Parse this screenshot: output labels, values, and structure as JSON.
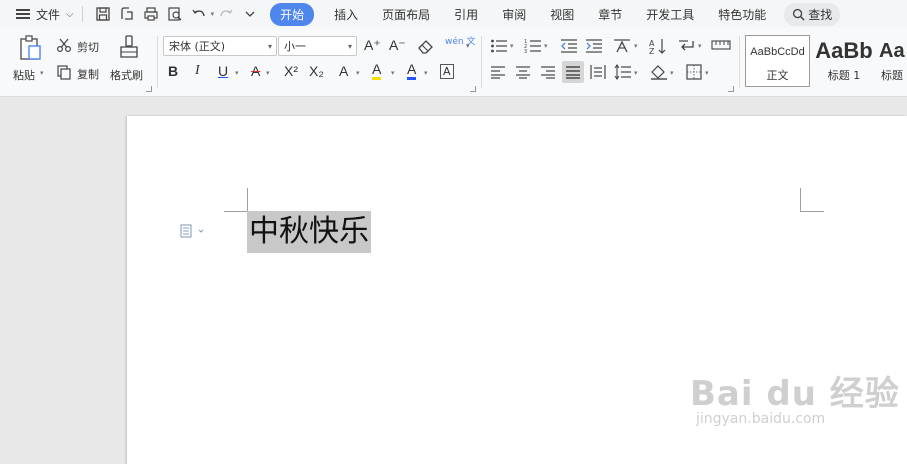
{
  "topbar": {
    "file_label": "文件",
    "tabs": [
      {
        "label": "开始",
        "active": true
      },
      {
        "label": "插入",
        "active": false
      },
      {
        "label": "页面布局",
        "active": false
      },
      {
        "label": "引用",
        "active": false
      },
      {
        "label": "审阅",
        "active": false
      },
      {
        "label": "视图",
        "active": false
      },
      {
        "label": "章节",
        "active": false
      },
      {
        "label": "开发工具",
        "active": false
      },
      {
        "label": "特色功能",
        "active": false
      }
    ],
    "search_label": "查找"
  },
  "ribbon": {
    "clipboard": {
      "paste": "粘贴",
      "cut": "剪切",
      "copy": "复制",
      "format_painter": "格式刷"
    },
    "font": {
      "family": "宋体 (正文)",
      "size": "小一",
      "bold": "B",
      "italic": "I",
      "underline": "U",
      "strike": "A",
      "superscript": "X²",
      "subscript": "X₂",
      "text_effect": "A",
      "highlight": "A",
      "font_color": "A",
      "char_border": "A",
      "grow": "A⁺",
      "shrink": "A⁻",
      "phonetic": "wén 文"
    },
    "styles": [
      {
        "sample": "AaBbCcDd",
        "name": "正文"
      },
      {
        "sample": "AaBb",
        "name": "标题 1"
      },
      {
        "sample": "AaI",
        "name": "标题"
      }
    ]
  },
  "document": {
    "text": "中秋快乐"
  },
  "watermark": {
    "main": "Bai du 经验",
    "sub": "jingyan.baidu.com"
  },
  "colors": {
    "accent": "#4e86ec",
    "highlight_yellow": "#f7e000",
    "font_color_blue": "#2255ff",
    "selection": "#c8c8c8"
  }
}
